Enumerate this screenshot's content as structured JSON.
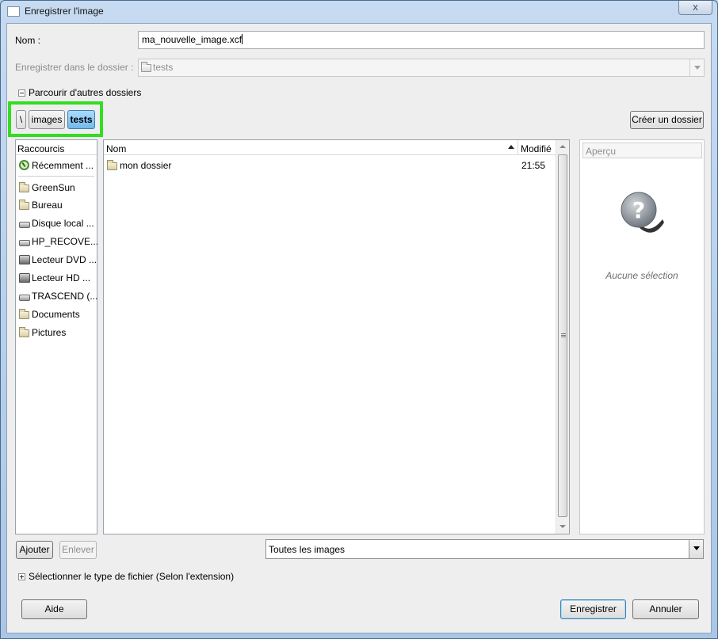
{
  "window": {
    "title": "Enregistrer l'image",
    "close_label": "x"
  },
  "name_row": {
    "label": "Nom :",
    "value": "ma_nouvelle_image.xcf"
  },
  "folder_row": {
    "label": "Enregistrer dans le dossier :",
    "value": "tests"
  },
  "browse_expander": {
    "label": "Parcourir d'autres dossiers"
  },
  "path_bar": {
    "items": [
      "\\",
      "images",
      "tests"
    ],
    "active_index": 2
  },
  "create_folder_button": "Créer un dossier",
  "places": {
    "header": "Raccourcis",
    "items": [
      {
        "label": "Récemment ...",
        "icon": "recent-icon"
      },
      {
        "label": "GreenSun",
        "icon": "folder-icon"
      },
      {
        "label": "Bureau",
        "icon": "folder-icon"
      },
      {
        "label": "Disque local ...",
        "icon": "drive-icon"
      },
      {
        "label": "HP_RECOVE...",
        "icon": "drive-icon"
      },
      {
        "label": "Lecteur DVD ...",
        "icon": "dvd-icon"
      },
      {
        "label": "Lecteur HD ...",
        "icon": "dvd-icon"
      },
      {
        "label": "TRASCEND (...",
        "icon": "drive-icon"
      },
      {
        "label": "Documents",
        "icon": "folder-icon"
      },
      {
        "label": "Pictures",
        "icon": "folder-icon"
      }
    ]
  },
  "files": {
    "columns": {
      "name": "Nom",
      "modified": "Modifié"
    },
    "rows": [
      {
        "name": "mon dossier",
        "modified": "21:55",
        "icon": "folder-icon"
      }
    ]
  },
  "preview": {
    "title": "Aperçu",
    "status": "Aucune sélection"
  },
  "add_button": "Ajouter",
  "remove_button": "Enlever",
  "filter_combo": {
    "value": "Toutes les images"
  },
  "filetype_expander": {
    "label": "Sélectionner le type de fichier (Selon l'extension)"
  },
  "help_button": "Aide",
  "save_button": "Enregistrer",
  "cancel_button": "Annuler",
  "colors": {
    "highlight_box": "#33dd22",
    "active_path": "#71b9ea"
  }
}
